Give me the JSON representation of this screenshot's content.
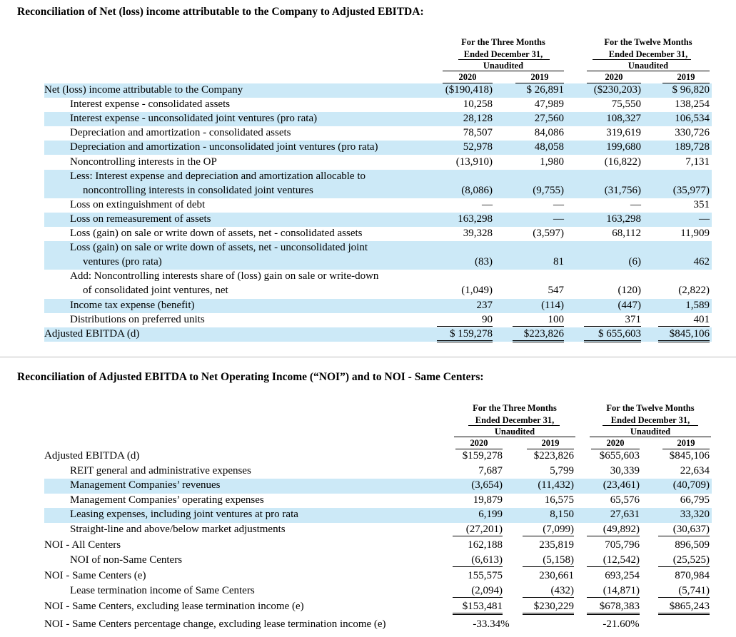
{
  "colors": {
    "shade": "#cce9f7"
  },
  "table1": {
    "title": "Reconciliation of Net (loss) income attributable to the Company to Adjusted EBITDA:",
    "header_three": [
      "For the Three Months",
      "Ended December 31,",
      "Unaudited"
    ],
    "header_twelve": [
      "For the Twelve Months",
      "Ended December 31,",
      "Unaudited"
    ],
    "years": [
      "2020",
      "2019",
      "2020",
      "2019"
    ],
    "rows": [
      {
        "lines": [
          "Net (loss) income attributable to the Company"
        ],
        "v": [
          "($190,418)",
          "$ 26,891",
          "($230,203)",
          "$ 96,820"
        ]
      },
      {
        "lines": [
          "Interest expense - consolidated assets"
        ],
        "v": [
          "10,258",
          "47,989",
          "75,550",
          "138,254"
        ]
      },
      {
        "lines": [
          "Interest expense - unconsolidated joint ventures (pro rata)"
        ],
        "v": [
          "28,128",
          "27,560",
          "108,327",
          "106,534"
        ]
      },
      {
        "lines": [
          "Depreciation and amortization - consolidated assets"
        ],
        "v": [
          "78,507",
          "84,086",
          "319,619",
          "330,726"
        ]
      },
      {
        "lines": [
          "Depreciation and amortization - unconsolidated joint ventures (pro rata)"
        ],
        "v": [
          "52,978",
          "48,058",
          "199,680",
          "189,728"
        ]
      },
      {
        "lines": [
          "Noncontrolling interests in the OP"
        ],
        "v": [
          "(13,910)",
          "1,980",
          "(16,822)",
          "7,131"
        ]
      },
      {
        "lines": [
          "Less: Interest expense and depreciation and amortization allocable to",
          "noncontrolling interests in consolidated joint ventures"
        ],
        "v": [
          "(8,086)",
          "(9,755)",
          "(31,756)",
          "(35,977)"
        ]
      },
      {
        "lines": [
          "Loss on extinguishment of debt"
        ],
        "v": [
          "—",
          "—",
          "—",
          "351"
        ]
      },
      {
        "lines": [
          "Loss on remeasurement of assets"
        ],
        "v": [
          "163,298",
          "—",
          "163,298",
          "—"
        ]
      },
      {
        "lines": [
          "Loss (gain) on sale or write down of assets, net - consolidated assets"
        ],
        "v": [
          "39,328",
          "(3,597)",
          "68,112",
          "11,909"
        ]
      },
      {
        "lines": [
          "Loss (gain) on sale or write down of assets, net - unconsolidated joint",
          "ventures (pro rata)"
        ],
        "v": [
          "(83)",
          "81",
          "(6)",
          "462"
        ]
      },
      {
        "lines": [
          "Add: Noncontrolling interests share of (loss) gain on sale or write-down",
          "of consolidated joint ventures, net"
        ],
        "v": [
          "(1,049)",
          "547",
          "(120)",
          "(2,822)"
        ]
      },
      {
        "lines": [
          "Income tax expense (benefit)"
        ],
        "v": [
          "237",
          "(114)",
          "(447)",
          "1,589"
        ]
      },
      {
        "lines": [
          "Distributions on preferred units"
        ],
        "v": [
          "90",
          "100",
          "371",
          "401"
        ]
      },
      {
        "lines": [
          "Adjusted EBITDA (d)"
        ],
        "v": [
          "$ 159,278",
          "$223,826",
          "$ 655,603",
          "$845,106"
        ]
      }
    ]
  },
  "table2": {
    "title": "Reconciliation of Adjusted EBITDA to Net Operating Income (“NOI”) and to NOI - Same Centers:",
    "header_three": [
      "For the Three Months",
      "Ended December 31,",
      "Unaudited"
    ],
    "header_twelve": [
      "For the Twelve Months",
      "Ended December 31,",
      "Unaudited"
    ],
    "years": [
      "2020",
      "2019",
      "2020",
      "2019"
    ],
    "rows": [
      {
        "lines": [
          "Adjusted EBITDA (d)"
        ],
        "v": [
          "$159,278",
          "$223,826",
          "$655,603",
          "$845,106"
        ]
      },
      {
        "lines": [
          "REIT general and administrative expenses"
        ],
        "v": [
          "7,687",
          "5,799",
          "30,339",
          "22,634"
        ]
      },
      {
        "lines": [
          "Management Companies’ revenues"
        ],
        "v": [
          "(3,654)",
          "(11,432)",
          "(23,461)",
          "(40,709)"
        ]
      },
      {
        "lines": [
          "Management Companies’ operating expenses"
        ],
        "v": [
          "19,879",
          "16,575",
          "65,576",
          "66,795"
        ]
      },
      {
        "lines": [
          "Leasing expenses, including joint ventures at pro rata"
        ],
        "v": [
          "6,199",
          "8,150",
          "27,631",
          "33,320"
        ]
      },
      {
        "lines": [
          "Straight-line and above/below market adjustments"
        ],
        "v": [
          "(27,201)",
          "(7,099)",
          "(49,892)",
          "(30,637)"
        ]
      },
      {
        "lines": [
          "NOI - All Centers"
        ],
        "v": [
          "162,188",
          "235,819",
          "705,796",
          "896,509"
        ]
      },
      {
        "lines": [
          "NOI of non-Same Centers"
        ],
        "v": [
          "(6,613)",
          "(5,158)",
          "(12,542)",
          "(25,525)"
        ]
      },
      {
        "lines": [
          "NOI - Same Centers (e)"
        ],
        "v": [
          "155,575",
          "230,661",
          "693,254",
          "870,984"
        ]
      },
      {
        "lines": [
          "Lease termination income of Same Centers"
        ],
        "v": [
          "(2,094)",
          "(432)",
          "(14,871)",
          "(5,741)"
        ]
      },
      {
        "lines": [
          "NOI - Same Centers, excluding lease termination income (e)"
        ],
        "v": [
          "$153,481",
          "$230,229",
          "$678,383",
          "$865,243"
        ]
      },
      {
        "lines": [
          "NOI - Same Centers percentage change, excluding lease termination income (e)"
        ],
        "pct": [
          "-33.34%",
          "-21.60%"
        ]
      }
    ]
  }
}
